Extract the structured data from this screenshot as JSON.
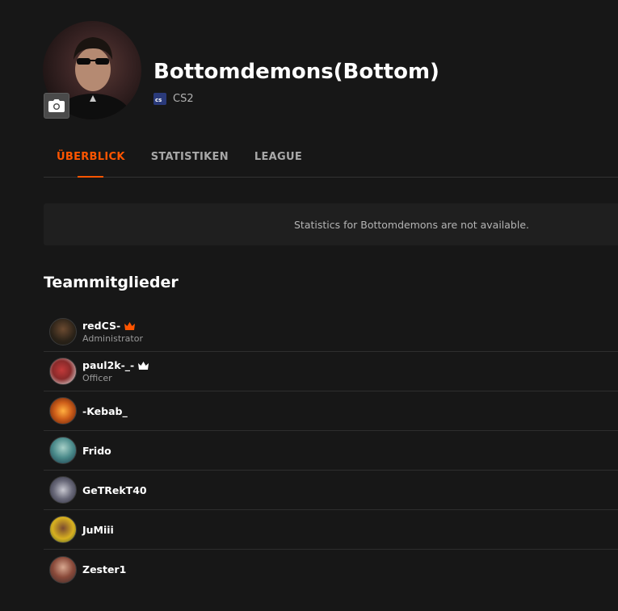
{
  "team": {
    "name": "Bottomdemons(Bottom)",
    "game_label": "CS2",
    "game_icon": "cs-game-icon"
  },
  "tabs": [
    {
      "label": "ÜBERBLICK",
      "active": true
    },
    {
      "label": "STATISTIKEN",
      "active": false
    },
    {
      "label": "LEAGUE",
      "active": false
    }
  ],
  "stats": {
    "message": "Statistics for Bottomdemons are not available."
  },
  "members_section": {
    "title": "Teammitglieder"
  },
  "members": [
    {
      "name": "redCS-",
      "role": "Administrator",
      "crown": "orange",
      "avatar_color": "#3a3020"
    },
    {
      "name": "paul2k-_-",
      "role": "Officer",
      "crown": "white",
      "avatar_color": "#8a2a2a"
    },
    {
      "name": "-Kebab_",
      "role": "",
      "crown": "",
      "avatar_color": "#b8501a"
    },
    {
      "name": "Frido",
      "role": "",
      "crown": "",
      "avatar_color": "#3a7a7a"
    },
    {
      "name": "GeTRekT40",
      "role": "",
      "crown": "",
      "avatar_color": "#5a5a6a"
    },
    {
      "name": "JuMiii",
      "role": "",
      "crown": "",
      "avatar_color": "#b89a20"
    },
    {
      "name": "Zester1",
      "role": "",
      "crown": "",
      "avatar_color": "#6a4a3a"
    }
  ],
  "colors": {
    "accent": "#ff5500",
    "background": "#171717",
    "panel": "#1f1f1f",
    "crown_orange": "#ff5500",
    "crown_white": "#ffffff"
  }
}
